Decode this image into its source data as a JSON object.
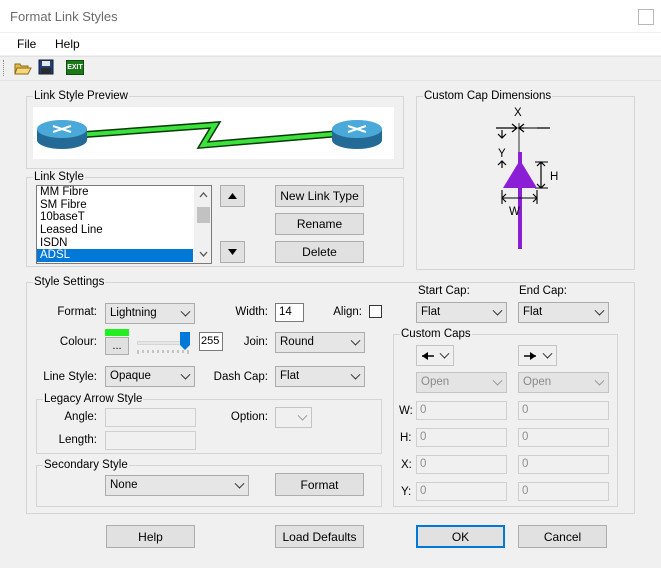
{
  "window": {
    "title": "Format Link Styles"
  },
  "menu": {
    "file": "File",
    "help": "Help"
  },
  "toolbar": {
    "open_icon": "folder-open-icon",
    "save_icon": "floppy-disk-icon",
    "exit_label": "EXIT"
  },
  "preview": {
    "group_label": "Link Style Preview"
  },
  "link_style": {
    "group_label": "Link Style",
    "items": [
      "MM Fibre",
      "SM Fibre",
      "10baseT",
      "Leased Line",
      "ISDN",
      "ADSL"
    ],
    "selected_index": 5,
    "new_button": "New Link Type",
    "rename_button": "Rename",
    "delete_button": "Delete"
  },
  "custom_cap_dimensions": {
    "group_label": "Custom Cap Dimensions",
    "x": "X",
    "y": "Y",
    "h": "H",
    "w": "W",
    "arrow_color": "#8a1fd6"
  },
  "style_settings": {
    "group_label": "Style Settings",
    "format_label": "Format:",
    "format_value": "Lightning",
    "width_label": "Width:",
    "width_value": "14",
    "align_label": "Align:",
    "colour_label": "Colour:",
    "colour_button": "...",
    "colour_swatch": "#22ee22",
    "colour_value": "255",
    "slider_fraction": 1.0,
    "join_label": "Join:",
    "join_value": "Round",
    "line_style_label": "Line Style:",
    "line_style_value": "Opaque",
    "dash_cap_label": "Dash Cap:",
    "dash_cap_value": "Flat",
    "start_cap_label": "Start Cap:",
    "start_cap_value": "Flat",
    "end_cap_label": "End Cap:",
    "end_cap_value": "Flat"
  },
  "legacy_arrow": {
    "group_label": "Legacy Arrow Style",
    "angle_label": "Angle:",
    "length_label": "Length:",
    "option_label": "Option:"
  },
  "custom_caps": {
    "group_label": "Custom Caps",
    "start_type": "Open",
    "end_type": "Open",
    "w_label": "W:",
    "h_label": "H:",
    "x_label": "X:",
    "y_label": "Y:",
    "start": {
      "w": "0",
      "h": "0",
      "x": "0",
      "y": "0"
    },
    "end": {
      "w": "0",
      "h": "0",
      "x": "0",
      "y": "0"
    }
  },
  "secondary_style": {
    "group_label": "Secondary Style",
    "value": "None",
    "format_button": "Format"
  },
  "footer": {
    "help": "Help",
    "load_defaults": "Load Defaults",
    "ok": "OK",
    "cancel": "Cancel"
  }
}
